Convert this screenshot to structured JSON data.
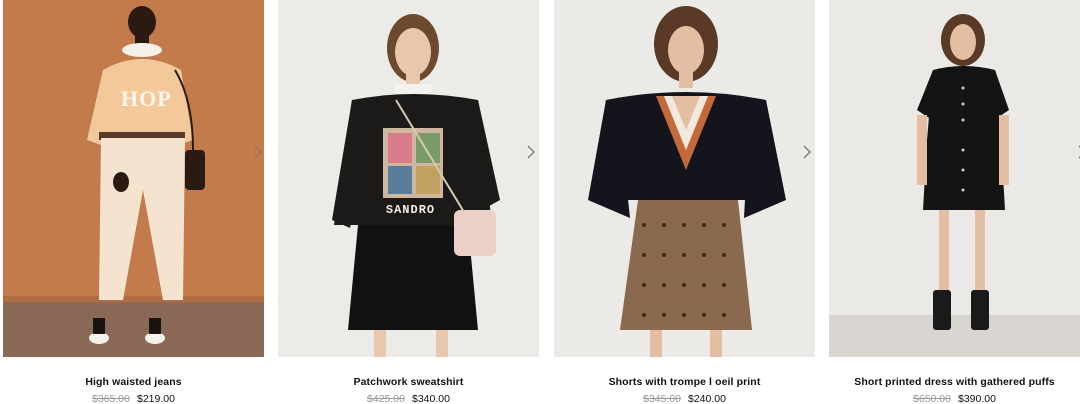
{
  "products": [
    {
      "name": "High waisted jeans",
      "old_price": "$365.00",
      "price": "$219.00"
    },
    {
      "name": "Patchwork sweatshirt",
      "old_price": "$425.00",
      "price": "$340.00"
    },
    {
      "name": "Shorts with trompe l oeil print",
      "old_price": "$345.00",
      "price": "$240.00"
    },
    {
      "name": "Short printed dress with gathered puffs",
      "old_price": "$650.00",
      "price": "$390.00"
    }
  ],
  "photo_text": {
    "hope": "HOP",
    "brand": "SANDRO"
  },
  "colors": {
    "old_price": "#9a9a9a",
    "text": "#111111",
    "card1_bg": "#c27b4e",
    "card_bg": "#eceae6"
  },
  "icons": {
    "next": "chevron-right-icon"
  }
}
